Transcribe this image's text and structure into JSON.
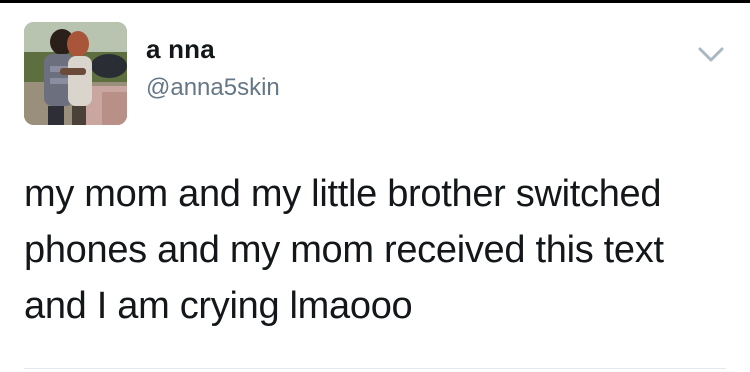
{
  "tweet": {
    "author": {
      "display_name": "a nna",
      "handle": "@anna5skin",
      "avatar_icon": "profile-photo"
    },
    "menu_icon": "chevron-down-icon",
    "text_lines": [
      "my mom and my little brother switched",
      "phones and my mom received this text",
      "and I am crying lmaooo"
    ]
  },
  "colors": {
    "text": "#14171a",
    "secondary_text": "#657786",
    "caret": "#aab8c2",
    "divider": "#e1e8ed"
  }
}
